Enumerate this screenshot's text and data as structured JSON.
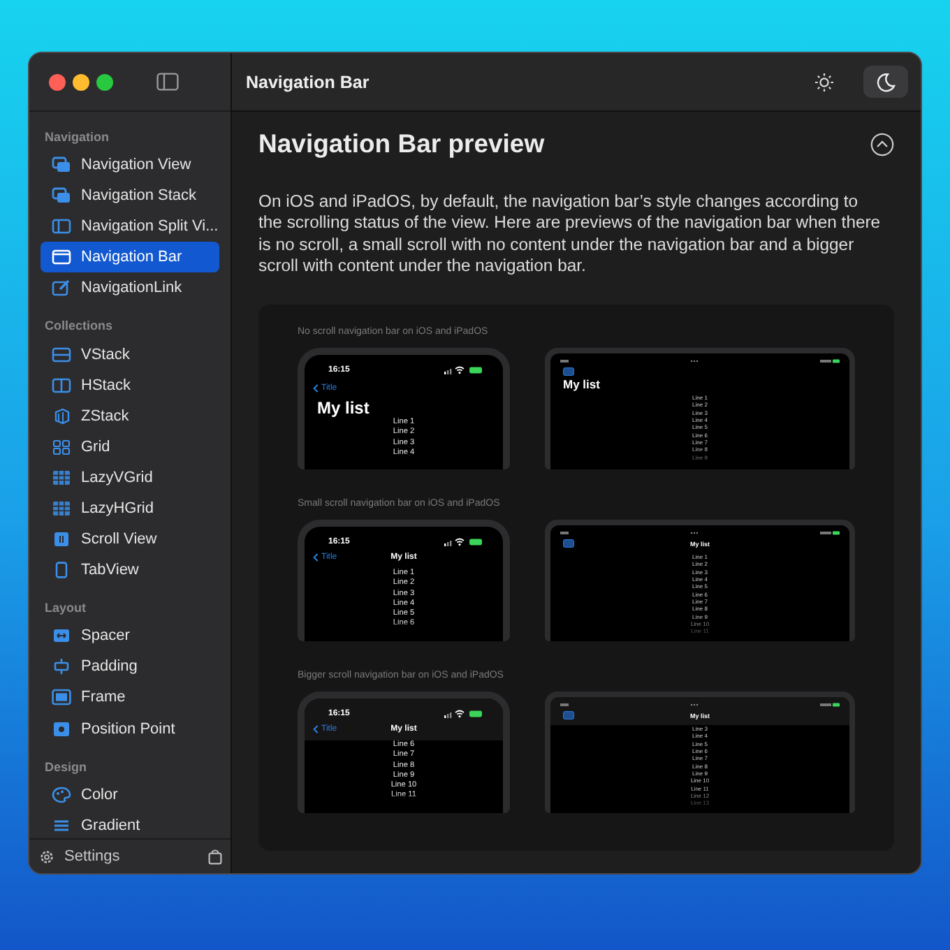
{
  "sidebar": {
    "sections": [
      {
        "title": "Navigation",
        "items": [
          {
            "label": "Navigation View",
            "kind": "windows",
            "selected": false
          },
          {
            "label": "Navigation Stack",
            "kind": "windows",
            "selected": false
          },
          {
            "label": "Navigation Split Vi...",
            "kind": "split",
            "selected": false
          },
          {
            "label": "Navigation Bar",
            "kind": "bar",
            "selected": true
          },
          {
            "label": "NavigationLink",
            "kind": "link",
            "selected": false
          }
        ]
      },
      {
        "title": "Collections",
        "items": [
          {
            "label": "VStack",
            "kind": "vstack",
            "selected": false
          },
          {
            "label": "HStack",
            "kind": "hstack",
            "selected": false
          },
          {
            "label": "ZStack",
            "kind": "zstack",
            "selected": false
          },
          {
            "label": "Grid",
            "kind": "grid",
            "selected": false
          },
          {
            "label": "LazyVGrid",
            "kind": "dots",
            "selected": false
          },
          {
            "label": "LazyHGrid",
            "kind": "dots",
            "selected": false
          },
          {
            "label": "Scroll View",
            "kind": "scroll",
            "selected": false
          },
          {
            "label": "TabView",
            "kind": "phone",
            "selected": false
          }
        ]
      },
      {
        "title": "Layout",
        "items": [
          {
            "label": "Spacer",
            "kind": "spacer",
            "selected": false
          },
          {
            "label": "Padding",
            "kind": "padding",
            "selected": false
          },
          {
            "label": "Frame",
            "kind": "frame",
            "selected": false
          },
          {
            "label": "Position Point",
            "kind": "position",
            "selected": false
          }
        ]
      },
      {
        "title": "Design",
        "items": [
          {
            "label": "Color",
            "kind": "palette",
            "selected": false
          },
          {
            "label": "Gradient",
            "kind": "lines",
            "selected": false
          }
        ]
      }
    ],
    "footer": {
      "label": "Settings"
    }
  },
  "toolbar": {
    "title": "Navigation Bar",
    "appearance": [
      {
        "kind": "light",
        "selected": false
      },
      {
        "kind": "dark",
        "selected": true
      }
    ]
  },
  "content": {
    "heading": "Navigation Bar preview",
    "expanded": true,
    "description": "On iOS and iPadOS, by default, the navigation bar’s style changes according to the scrolling status of the view. Here are previews of the navigation bar when there is no scroll, a small scroll with no content under the navigation bar and a bigger scroll with content under the navigation bar.",
    "previews": [
      {
        "caption": "No scroll navigation bar on iOS and iPadOS",
        "kind": "large",
        "phone": {
          "time": "16:15",
          "back": "Title",
          "title": "My list",
          "lines": [
            "Line 1",
            "Line 2",
            "Line 3",
            "Line 4"
          ]
        },
        "tablet": {
          "title": "My list",
          "lines": [
            "Line 1",
            "Line 2",
            "Line 3",
            "Line 4",
            "Line 5",
            "Line 6",
            "Line 7",
            "Line 8",
            "Line 9"
          ]
        }
      },
      {
        "caption": "Small scroll navigation bar on iOS and iPadOS",
        "kind": "inline",
        "phone": {
          "time": "16:15",
          "back": "Title",
          "title": "My list",
          "lines": [
            "Line 1",
            "Line 2",
            "Line 3",
            "Line 4",
            "Line 5",
            "Line 6"
          ]
        },
        "tablet": {
          "title": "My list",
          "lines": [
            "Line 1",
            "Line 2",
            "Line 3",
            "Line 4",
            "Line 5",
            "Line 6",
            "Line 7",
            "Line 8",
            "Line 9",
            "Line 10",
            "Line 11"
          ]
        }
      },
      {
        "caption": "Bigger scroll navigation bar on iOS and iPadOS",
        "kind": "scrolled",
        "phone": {
          "time": "16:15",
          "back": "Title",
          "title": "My list",
          "lines": [
            "Line 6",
            "Line 7",
            "Line 8",
            "Line 9",
            "Line 10",
            "Line 11"
          ]
        },
        "tablet": {
          "title": "My list",
          "lines": [
            "Line 3",
            "Line 4",
            "Line 5",
            "Line 6",
            "Line 7",
            "Line 8",
            "Line 9",
            "Line 10",
            "Line 11",
            "Line 12",
            "Line 13"
          ]
        }
      }
    ]
  }
}
